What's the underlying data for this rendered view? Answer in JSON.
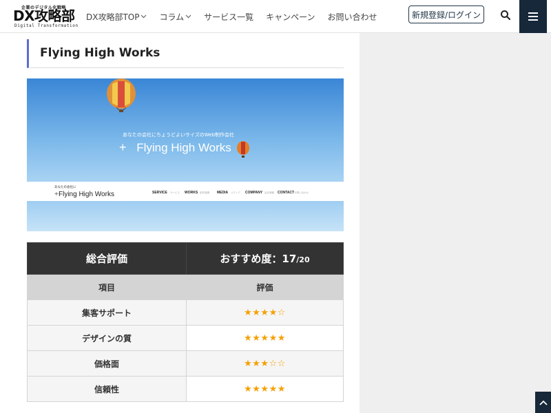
{
  "header": {
    "logo_tagline": "企業のデジタル化戦略",
    "logo_mark": "DX攻略部",
    "logo_sub": "Digital Transformation",
    "nav": [
      {
        "label": "DX攻略部TOP",
        "has_dropdown": true
      },
      {
        "label": "コラム",
        "has_dropdown": true
      },
      {
        "label": "サービス一覧",
        "has_dropdown": false
      },
      {
        "label": "キャンペーン",
        "has_dropdown": false
      },
      {
        "label": "お問い合わせ",
        "has_dropdown": false
      }
    ],
    "login_label": "新規登録/ログイン",
    "search_icon": "search-icon",
    "menu_icon": "hamburger-menu-icon"
  },
  "article": {
    "title": "Flying High Works",
    "hero": {
      "tagline": "あなたの会社にちょうどよいサイズのWeb制作会社",
      "brand": "Flying High Works",
      "small_tagline": "あなたの会社に",
      "menu": [
        {
          "en": "SERVICE",
          "ja": "サービス"
        },
        {
          "en": "WORKS",
          "ja": "制作実績"
        },
        {
          "en": "MEDIA",
          "ja": "メディア"
        },
        {
          "en": "COMPANY",
          "ja": "会社情報"
        },
        {
          "en": "CONTACT",
          "ja": "お問い合わせ"
        }
      ]
    },
    "evaluation": {
      "overall_label": "総合評価",
      "score_label": "おすすめ度：",
      "score_value": "17",
      "score_total": "/20",
      "col_item": "項目",
      "col_rating": "評価",
      "rows": [
        {
          "item": "集客サポート",
          "stars": "★★★★☆",
          "rating": 4
        },
        {
          "item": "デザインの質",
          "stars": "★★★★★",
          "rating": 5
        },
        {
          "item": "価格面",
          "stars": "★★★☆☆",
          "rating": 3
        },
        {
          "item": "信頼性",
          "stars": "★★★★★",
          "rating": 5
        }
      ]
    }
  },
  "colors": {
    "accent": "#5b6bd6",
    "navy": "#16283a",
    "star": "#f5a000",
    "table_head": "#333333"
  },
  "scroll_top_icon": "chevron-up-icon"
}
